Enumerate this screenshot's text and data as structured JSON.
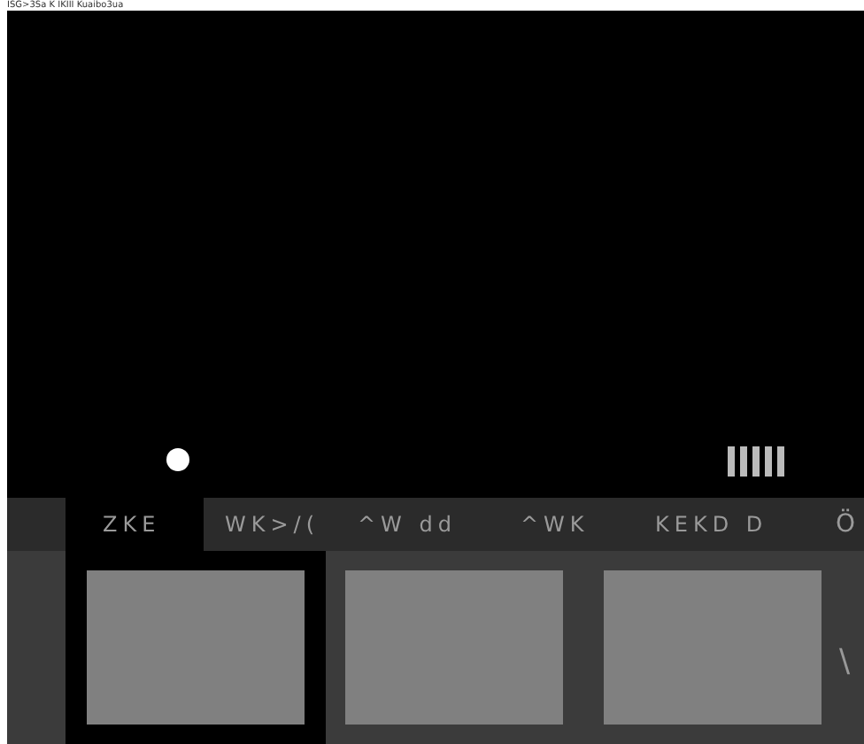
{
  "header_text": "ISG>3Sa K IKIII Kuaibo3ua",
  "tabs": [
    {
      "label": "ZKE",
      "selected": true
    },
    {
      "label": "WK>/(",
      "selected": false
    },
    {
      "label": "^W dd",
      "selected": false
    },
    {
      "label": "^WK",
      "selected": false
    },
    {
      "label": "KEKD D",
      "selected": false
    },
    {
      "label": "Ö",
      "selected": false
    }
  ],
  "thumbnails": [
    {
      "selected": true
    },
    {
      "selected": false
    },
    {
      "selected": false
    }
  ],
  "side_mark": "\\"
}
